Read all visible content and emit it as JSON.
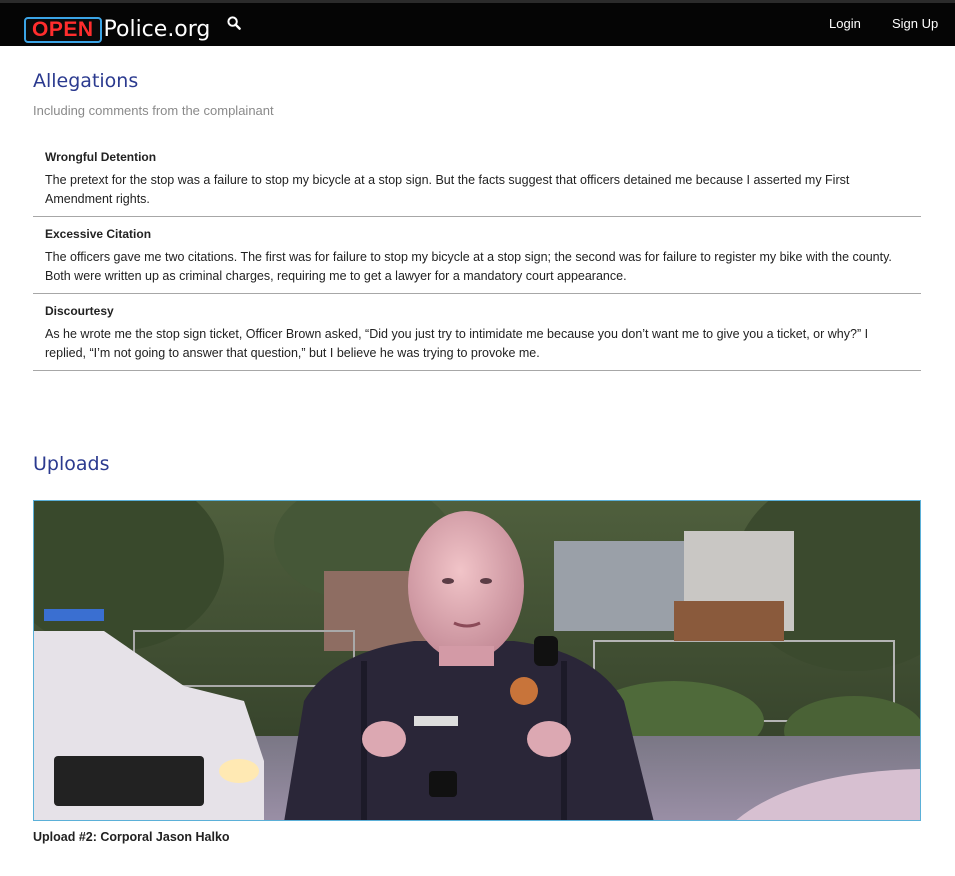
{
  "header": {
    "logo_open": "OPEN",
    "logo_rest": "Police.org",
    "login_label": "Login",
    "signup_label": "Sign Up"
  },
  "allegations": {
    "title": "Allegations",
    "subtitle": "Including comments from the complainant",
    "items": [
      {
        "title": "Wrongful Detention",
        "text": "The pretext for the stop was a failure to stop my bicycle at a stop sign. But the facts suggest that officers detained me because I asserted my First Amendment rights."
      },
      {
        "title": "Excessive Citation",
        "text": "The officers gave me two citations. The first was for failure to stop my bicycle at a stop sign; the second was for failure to register my bike with the county. Both were written up as criminal charges, requiring me to get a lawyer for a mandatory court appearance."
      },
      {
        "title": "Discourtesy",
        "text": "As he wrote me the stop sign ticket, Officer Brown asked, “Did you just try to intimidate me because you don’t want me to give you a ticket, or why?” I replied, “I’m not going to answer that question,” but I believe he was trying to provoke me."
      }
    ]
  },
  "uploads": {
    "title": "Uploads",
    "items": [
      {
        "caption": "Upload #2: Corporal Jason Halko"
      }
    ]
  }
}
